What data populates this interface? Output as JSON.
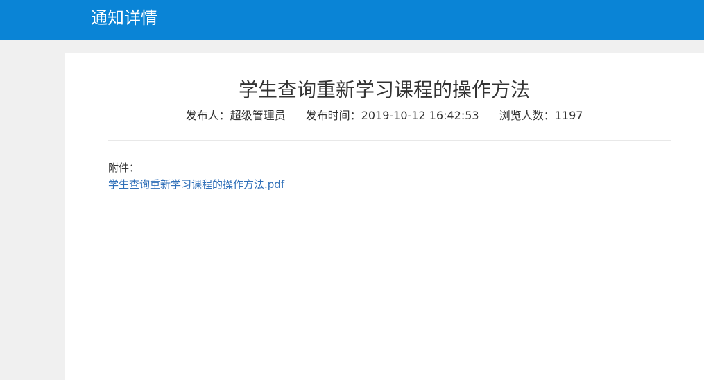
{
  "header": {
    "title": "通知详情",
    "bg_color": "#0a84d6"
  },
  "article": {
    "title": "学生查询重新学习课程的操作方法",
    "meta": {
      "publisher": "发布人：超级管理员",
      "publish_time": "发布时间：2019-10-12 16:42:53",
      "views": "浏览人数：1197"
    },
    "attachment_label": "附件：",
    "attachment_file": "学生查询重新学习课程的操作方法.pdf",
    "link_color": "#2f6fb8"
  }
}
